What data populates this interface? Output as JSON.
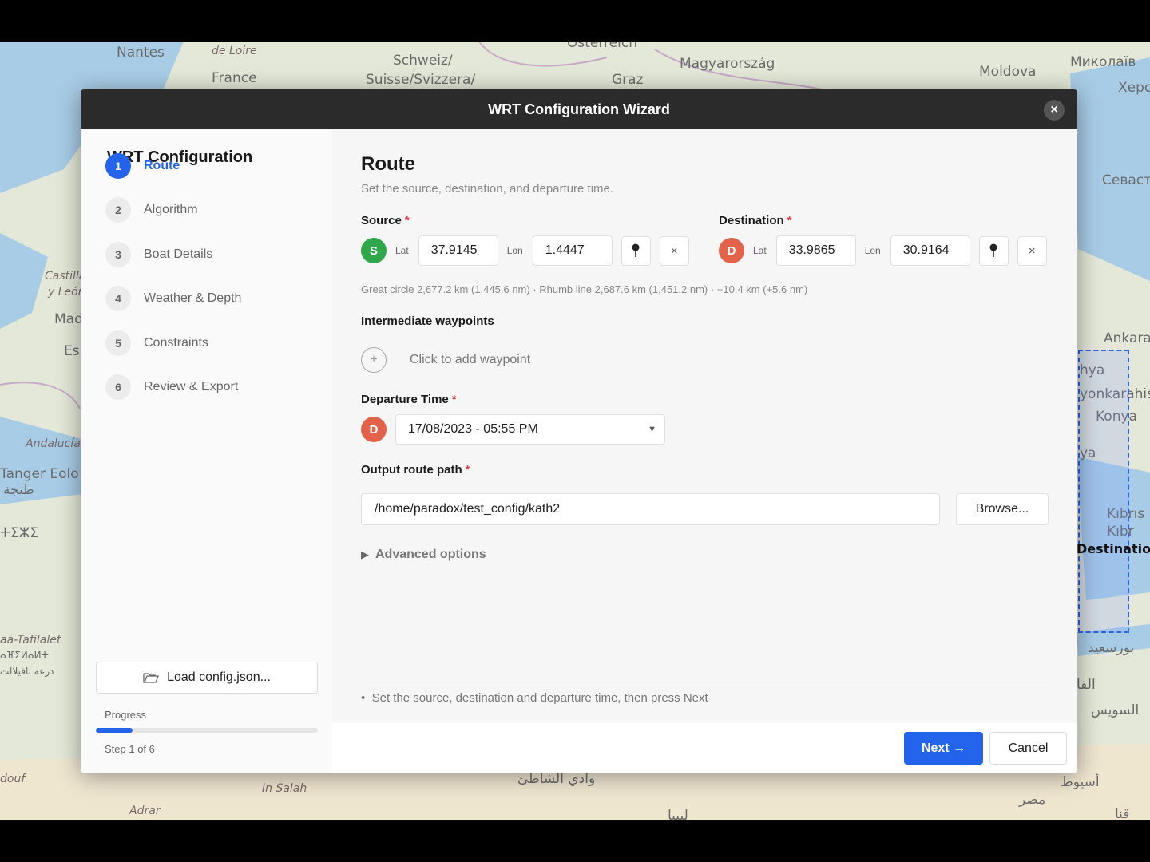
{
  "map": {
    "labels": [
      "Nantes",
      "de Loire",
      "France",
      "Schweiz/",
      "Suisse/Svizzera/",
      "Österreich",
      "Graz",
      "Magyarország",
      "Миколаїв",
      "Moldova",
      "Херс",
      "Севаст",
      "Castilla",
      "y León",
      "Mad",
      "Es",
      "Andalucía",
      "Tanger Eolo",
      "طنجة",
      "ⵜⵉⵣⵉ",
      "Ankara",
      "hya",
      "yonkarahis",
      "Konya",
      "ya",
      "Kıbrıs",
      "Kıbr",
      "Destination",
      "بورسعيد",
      "القا",
      "السويس",
      "aa-Tafilalet",
      "ⴰⴼⵉⵍⴰⵍⵜ",
      "درعة تافيلالت",
      "douf",
      "In Salah",
      "Adrar",
      "وادي الشاطئ",
      "أسيوط",
      "مصر",
      "ليبيا",
      "قنا"
    ],
    "destination_label": "Destination"
  },
  "dialog": {
    "title": "WRT Configuration Wizard",
    "close_icon": "×"
  },
  "sidebar": {
    "title": "WRT Configuration",
    "steps": [
      {
        "num": "1",
        "label": "Route"
      },
      {
        "num": "2",
        "label": "Algorithm"
      },
      {
        "num": "3",
        "label": "Boat Details"
      },
      {
        "num": "4",
        "label": "Weather & Depth"
      },
      {
        "num": "5",
        "label": "Constraints"
      },
      {
        "num": "6",
        "label": "Review & Export"
      }
    ],
    "load_label": "Load config.json...",
    "progress_label": "Progress",
    "progress_fraction": 0.1667,
    "progress_step": "Step 1 of 6"
  },
  "route": {
    "title": "Route",
    "subtitle": "Set the source, destination, and departure time.",
    "source_label": "Source",
    "destination_label": "Destination",
    "required_mark": "*",
    "source": {
      "badge": "S",
      "lat_label": "Lat",
      "lat": "37.9145",
      "lon_label": "Lon",
      "lon": "1.4447"
    },
    "destination": {
      "badge": "D",
      "lat_label": "Lat",
      "lat": "33.9865",
      "lon_label": "Lon",
      "lon": "30.9164"
    },
    "pin_icon": "📍",
    "clear_icon": "×",
    "distance": "Great circle 2,677.2 km (1,445.6 nm)  ·  Rhumb line 2,687.6 km (1,451.2 nm)  ·  +10.4 km (+5.6 nm)",
    "waypoints_label": "Intermediate waypoints",
    "add_waypoint": "Click to add waypoint",
    "departure_label": "Departure Time",
    "departure_badge": "D",
    "departure_value": "17/08/2023 - 05:55 PM",
    "output_label": "Output route path",
    "output_value": "/home/paradox/test_config/kath2",
    "browse_label": "Browse...",
    "advanced_label": "Advanced options",
    "hint": "Set the source, destination and departure time, then press Next"
  },
  "footer": {
    "next_label": "Next →",
    "cancel_label": "Cancel"
  },
  "colors": {
    "accent": "#2463eb",
    "source_badge": "#2ea84a",
    "destination_badge": "#e2634a",
    "header_bg": "#2b2b2b"
  }
}
